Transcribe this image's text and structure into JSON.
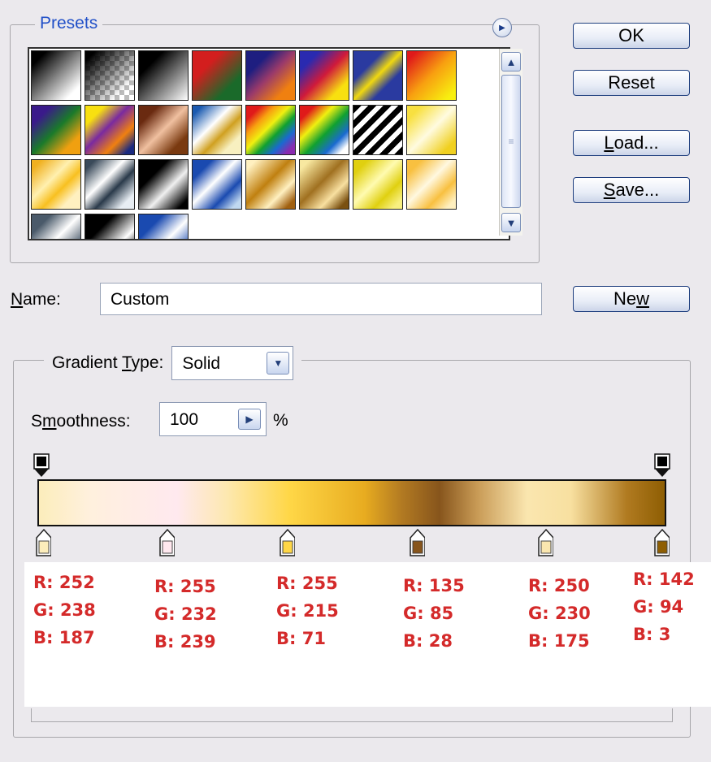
{
  "presets": {
    "legend": "Presets",
    "swatches": [
      "linear-gradient(135deg,#000 15%,#fff 85%)",
      "linear-gradient(135deg,#000 10%,rgba(0,0,0,0) 80%),repeating-conic-gradient(#bbb 0% 25%,#fff 0% 50%) 0 0/12px 12px",
      "linear-gradient(135deg,#000 25%,#fff 100%)",
      "linear-gradient(135deg,#d31e1e 30%,#1a6a2a 75%)",
      "linear-gradient(135deg,#1e1e80 25%,#9a3a6a 50%,#f08010 80%)",
      "linear-gradient(135deg,#2a2ab0 20%,#d01a3a 50%,#f8e010 80%)",
      "linear-gradient(135deg,#2a3aa0 30%,#f0d810 50%,#2a3aa0 70%)",
      "linear-gradient(135deg,#e01a1a 10%,#f8a010 50%,#f8f010 90%)",
      "linear-gradient(135deg,#3a1a8a 20%,#1a7a2a 50%,#f0a010 80%)",
      "linear-gradient(135deg,#f8e010 20%,#7a2aa0 45%,#f08010 70%,#1a2a80 90%)",
      "linear-gradient(135deg,#6a2a10 20%,#f0c0a0 50%,#7a3a10 80%)",
      "linear-gradient(135deg,#1a5ab0 10%,#ffffff 40%,#d0a020 60%,#f8f0c0 80%)",
      "linear-gradient(135deg,#e01a1a 15%,#f8a010 30%,#f0f010 45%,#10a030 60%,#1a6ad0 75%,#8a2ab0 90%)",
      "linear-gradient(135deg,#e01a1a 15%,#f0f010 35%,#10a030 55%,#1a6ad0 75%,#ffffff 90%)",
      "repeating-linear-gradient(135deg,#000 0 7px,#fff 7px 13px)",
      "linear-gradient(135deg,#f8e040 15%,#fffbe0 50%,#f0d020 85%)",
      "linear-gradient(135deg,#f0b020 10%,#fff0b0 40%,#f8c020 60%,#fff0c0 80%)",
      "linear-gradient(135deg,#3a4a5a 10%,#ffffff 40%,#2a3a4a 60%,#e8eef4 85%)",
      "linear-gradient(135deg,#000 30%,#f0f0f0 60%,#000 90%)",
      "linear-gradient(135deg,#1a4ab0 20%,#ffffff 45%,#1a4ab0 70%,#c0d8f0 90%)",
      "linear-gradient(135deg,#fff0c0 10%,#c08010 45%,#fff0c0 70%,#a06010 90%)",
      "linear-gradient(135deg,#f8e8a0 10%,#a07020 45%,#f8e0a0 70%,#7a5010 90%)",
      "linear-gradient(135deg,#e0d010 15%,#fffbb0 45%,#e0d010 70%,#f8f080 90%)",
      "linear-gradient(135deg,#f8c040 15%,#fff8e0 45%,#f8c040 70%,#fff0c0 90%)",
      "linear-gradient(135deg,#4a5a6a 20%,#ffffff 50%,#4a5a6a 80%)",
      "linear-gradient(135deg,#000 30%,#fff 65%,#000 90%)",
      "linear-gradient(135deg,#1a4ab0 25%,#ffffff 55%,#1a4ab0 85%)"
    ]
  },
  "buttons": {
    "ok": "OK",
    "reset": "Reset",
    "load_u": "L",
    "load_rest": "oad...",
    "save_u": "S",
    "save_rest": "ave...",
    "new_pre": "Ne",
    "new_u": "w"
  },
  "name": {
    "label_u": "N",
    "label_rest": "ame:",
    "value": "Custom"
  },
  "gradient_type": {
    "label_pre": "Gradient ",
    "label_u": "T",
    "label_rest": "ype:",
    "value": "Solid"
  },
  "smoothness": {
    "label_pre": "S",
    "label_u": "m",
    "label_rest": "oothness:",
    "value": "100",
    "unit": "%"
  },
  "gradient": {
    "css": "linear-gradient(90deg,#fcedbb 0%,#fff0dd 8%,#ffe9ef 22%,#fde8b0 30%,#ffd747 40%,#e8ac20 52%,#b27a22 58%,#87551c 64%,#c89a55 70%,#faE6af 78%,#f8e0a0 85%,#b07a20 94%,#8e5e03 100%)",
    "color_stops": [
      {
        "color": "#fcedbb"
      },
      {
        "color": "#ffe8ef"
      },
      {
        "color": "#ffd747"
      },
      {
        "color": "#87551c"
      },
      {
        "color": "#fae6af"
      },
      {
        "color": "#8e5e03"
      }
    ]
  },
  "stop_values": [
    {
      "r": "R: 252",
      "g": "G: 238",
      "b": "B: 187"
    },
    {
      "r": "R: 255",
      "g": "G: 232",
      "b": "B: 239"
    },
    {
      "r": "R: 255",
      "g": "G: 215",
      "b": "B: 71"
    },
    {
      "r": "R: 135",
      "g": "G: 85",
      "b": "B: 28"
    },
    {
      "r": "R: 250",
      "g": "G: 230",
      "b": "B: 175"
    },
    {
      "r": "R: 142",
      "g": "G: 94",
      "b": "B: 3"
    }
  ]
}
